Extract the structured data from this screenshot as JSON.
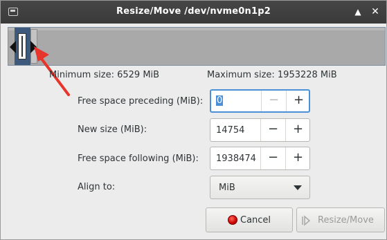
{
  "window": {
    "title": "Resize/Move /dev/nvme0n1p2",
    "icon": "dialog-window-icon",
    "controls": {
      "up": "▲",
      "close": "✕"
    }
  },
  "graphic": {
    "handles": [
      "left-resize-handle",
      "right-resize-handle"
    ],
    "colors": {
      "partition": "#3d5a7c",
      "unallocated": "#a9a9a9",
      "border": "#7d8fa3"
    }
  },
  "sizes": {
    "minimum": "Minimum size: 6529 MiB",
    "maximum": "Maximum size: 1953228 MiB"
  },
  "fields": {
    "preceding": {
      "label": "Free space preceding (MiB):",
      "value": "0",
      "minus_disabled": true
    },
    "new_size": {
      "label": "New size (MiB):",
      "value": "14754"
    },
    "following": {
      "label": "Free space following (MiB):",
      "value": "1938474"
    },
    "align": {
      "label": "Align to:",
      "value": "MiB"
    }
  },
  "buttons": {
    "minus": "−",
    "plus": "+",
    "cancel": "Cancel",
    "resize_move": "Resize/Move"
  },
  "annotation": {
    "arrow_color": "#e8352c"
  },
  "colors": {
    "accent": "#4a90d9",
    "titlebar": "#3f3f3f"
  }
}
